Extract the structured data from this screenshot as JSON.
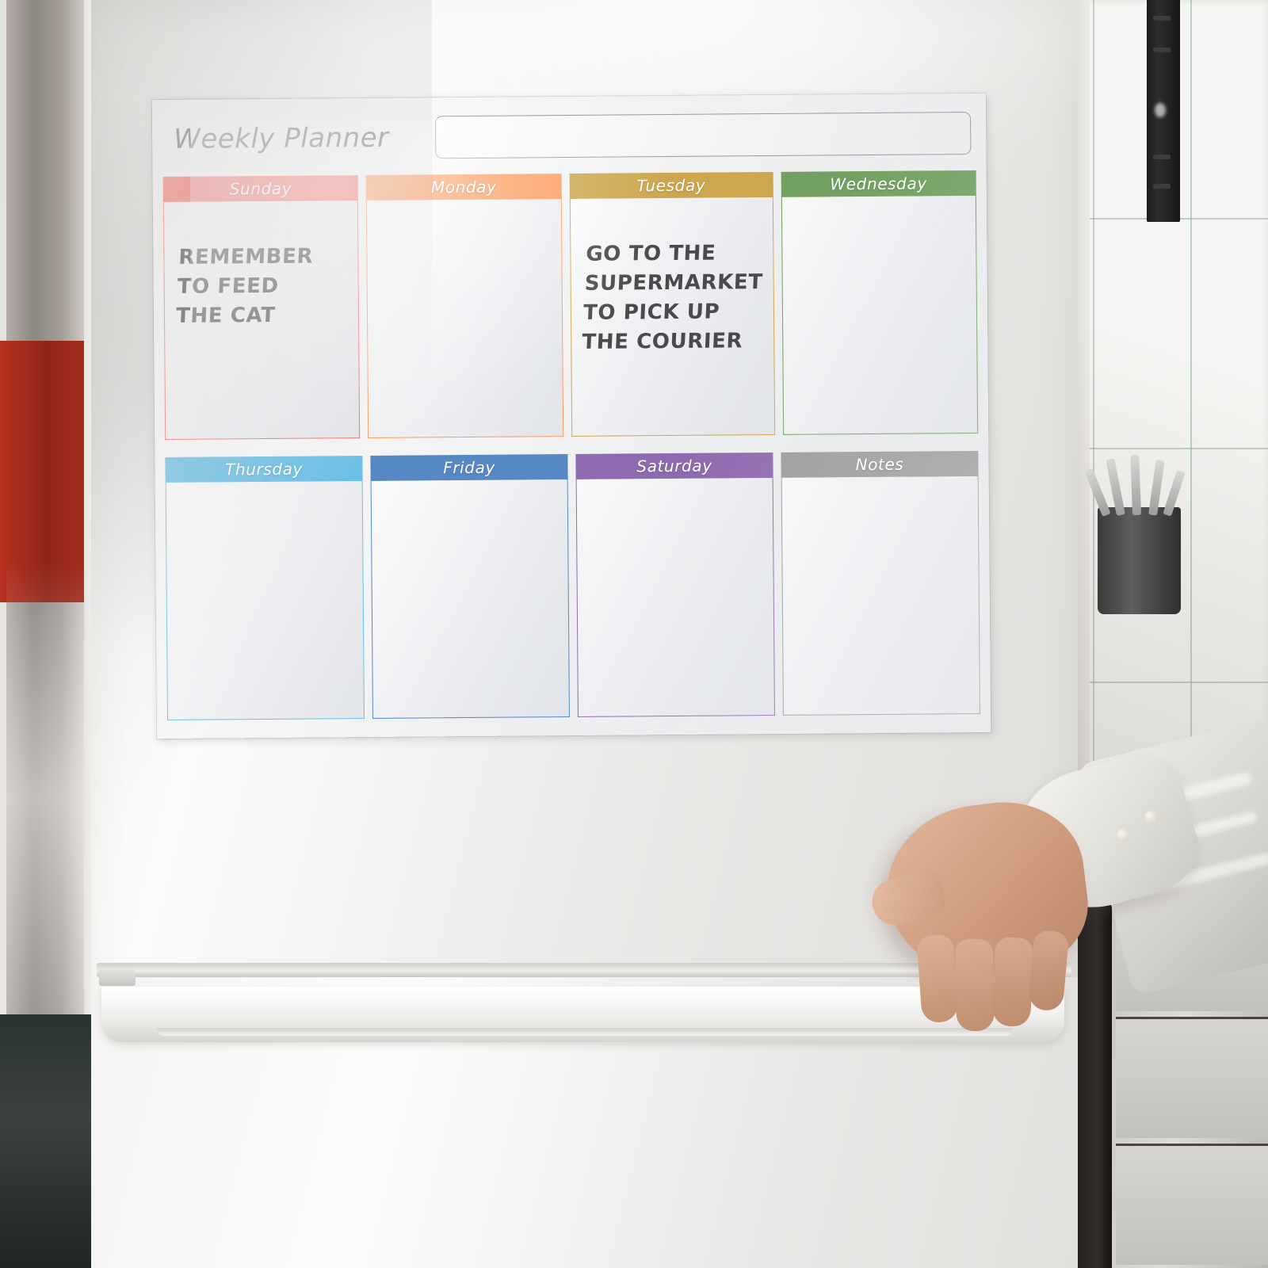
{
  "board": {
    "title": "Weekly Planner",
    "title_field_value": "",
    "title_field_placeholder": ""
  },
  "week": {
    "row1": [
      {
        "day": "Sunday",
        "color": "#fa6e66",
        "note": "REMEMBER\nTO FEED\nTHE CAT"
      },
      {
        "day": "Monday",
        "color": "#fb9b5e",
        "note": ""
      },
      {
        "day": "Tuesday",
        "color": "#cda74f",
        "note": "GO TO THE\nSUPERMARKET\nTO PICK UP\nTHE COURIER"
      },
      {
        "day": "Wednesday",
        "color": "#72a060",
        "note": ""
      }
    ],
    "row2": [
      {
        "day": "Thursday",
        "color": "#6cc0e5",
        "note": ""
      },
      {
        "day": "Friday",
        "color": "#5788c6",
        "note": ""
      },
      {
        "day": "Saturday",
        "color": "#8e6bb0",
        "note": ""
      },
      {
        "day": "Notes",
        "color": "#9e9c9c",
        "note": ""
      }
    ]
  },
  "scene": {
    "appliance": "refrigerator",
    "hand_label": "hand-on-fridge-door",
    "wall_fixture_label": "black-wall-fixture",
    "utensil_holder_label": "utensil-holder"
  },
  "palette": {
    "fridge_white": "#f3f2f0",
    "board_white": "#fbfbfb",
    "title_ink": "#6e6a66",
    "marker_ink": "#4a4a4c",
    "tile_grout": "#8fae9f",
    "pillar_red": "#b93222"
  }
}
